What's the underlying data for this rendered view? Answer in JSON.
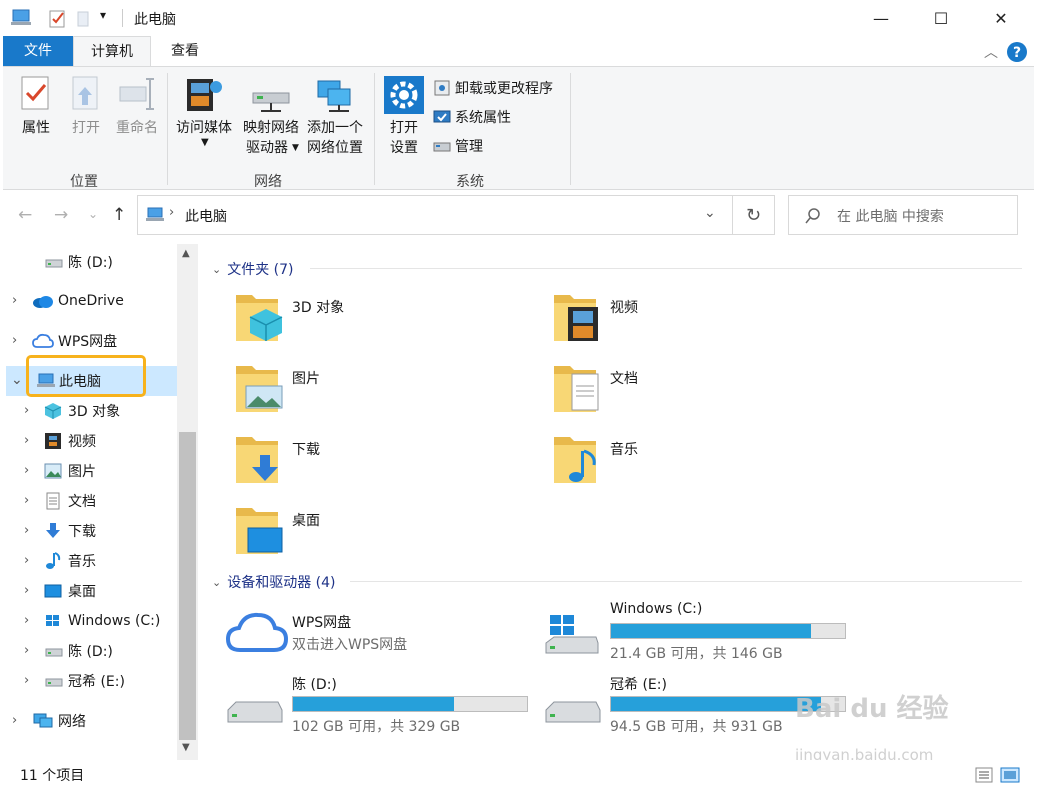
{
  "window": {
    "title": "此电脑",
    "minimize": "—",
    "maximize": "☐",
    "close": "✕"
  },
  "ribbon": {
    "tabs": {
      "file": "文件",
      "computer": "计算机",
      "view": "查看"
    },
    "location": {
      "label": "位置",
      "properties": "属性",
      "open": "打开",
      "rename": "重命名"
    },
    "network": {
      "label": "网络",
      "media_line1": "访问媒体",
      "map_line1": "映射网络",
      "map_line2": "驱动器",
      "add_line1": "添加一个",
      "add_line2": "网络位置"
    },
    "system": {
      "label": "系统",
      "settings_line1": "打开",
      "settings_line2": "设置",
      "uninstall": "卸载或更改程序",
      "sysprops": "系统属性",
      "manage": "管理"
    }
  },
  "address": {
    "path": "此电脑",
    "search_placeholder": "在 此电脑 中搜索"
  },
  "nav": {
    "items": [
      {
        "label": "陈 (D:)"
      },
      {
        "label": "OneDrive"
      },
      {
        "label": "WPS网盘"
      },
      {
        "label": "此电脑"
      },
      {
        "label": "3D 对象"
      },
      {
        "label": "视频"
      },
      {
        "label": "图片"
      },
      {
        "label": "文档"
      },
      {
        "label": "下载"
      },
      {
        "label": "音乐"
      },
      {
        "label": "桌面"
      },
      {
        "label": "Windows (C:)"
      },
      {
        "label": "陈 (D:)"
      },
      {
        "label": "冠希 (E:)"
      },
      {
        "label": "网络"
      }
    ]
  },
  "content": {
    "folders_header": "文件夹 (7)",
    "folders": [
      {
        "label": "3D 对象"
      },
      {
        "label": "视频"
      },
      {
        "label": "图片"
      },
      {
        "label": "文档"
      },
      {
        "label": "下载"
      },
      {
        "label": "音乐"
      },
      {
        "label": "桌面"
      }
    ],
    "devices_header": "设备和驱动器 (4)",
    "devices": [
      {
        "name": "WPS网盘",
        "sub": "双击进入WPS网盘"
      },
      {
        "name": "Windows (C:)",
        "sub": "21.4 GB 可用，共 146 GB",
        "used_fraction": 0.853
      },
      {
        "name": "陈 (D:)",
        "sub": "102 GB 可用，共 329 GB",
        "used_fraction": 0.69
      },
      {
        "name": "冠希 (E:)",
        "sub": "94.5 GB 可用，共 931 GB",
        "used_fraction": 0.898
      }
    ]
  },
  "status": {
    "count": "11 个项目"
  },
  "watermark": {
    "brand": "Bai du 经验",
    "url": "jingyan.baidu.com"
  },
  "colors": {
    "accent": "#1979ca",
    "selection": "#cce8ff",
    "highlight": "#f7b21c",
    "drive_bar": "#26a0da",
    "header_text": "#1e3287"
  }
}
